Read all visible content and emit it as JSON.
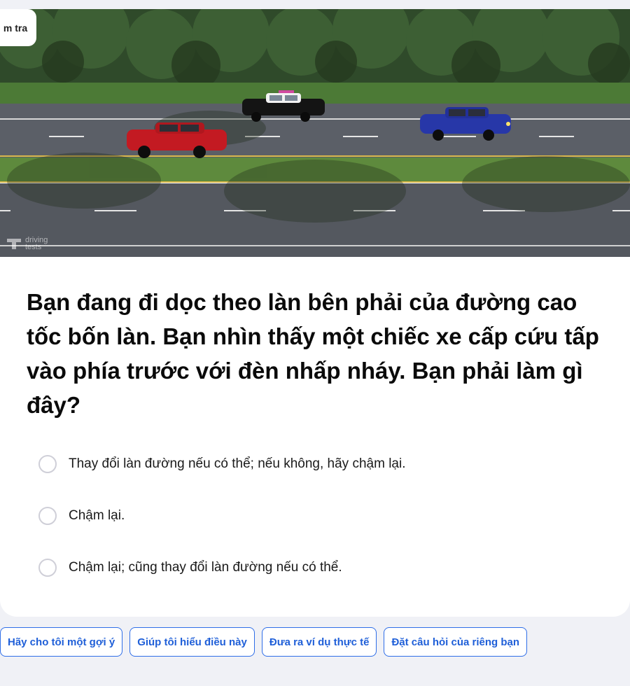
{
  "badge": {
    "label": "m tra"
  },
  "image": {
    "watermark": "driving tests",
    "alt": "road-scene"
  },
  "question": {
    "text": "Bạn đang đi dọc theo làn bên phải của đường cao tốc bốn làn. Bạn nhìn thấy một chiếc xe cấp cứu tấp vào phía trước với đèn nhấp nháy. Bạn phải làm gì đây?"
  },
  "options": [
    {
      "label": "Thay đổi làn đường nếu có thể; nếu không, hãy chậm lại."
    },
    {
      "label": "Chậm lại."
    },
    {
      "label": "Chậm lại; cũng thay đổi làn đường nếu có thể."
    }
  ],
  "chips": [
    {
      "label": "Hãy cho tôi một gợi ý"
    },
    {
      "label": "Giúp tôi hiểu điều này"
    },
    {
      "label": "Đưa ra ví dụ thực tế"
    },
    {
      "label": "Đặt câu hỏi của riêng bạn"
    }
  ],
  "colors": {
    "accent": "#2f6ee8",
    "background": "#f0f1f6",
    "card": "#ffffff"
  }
}
